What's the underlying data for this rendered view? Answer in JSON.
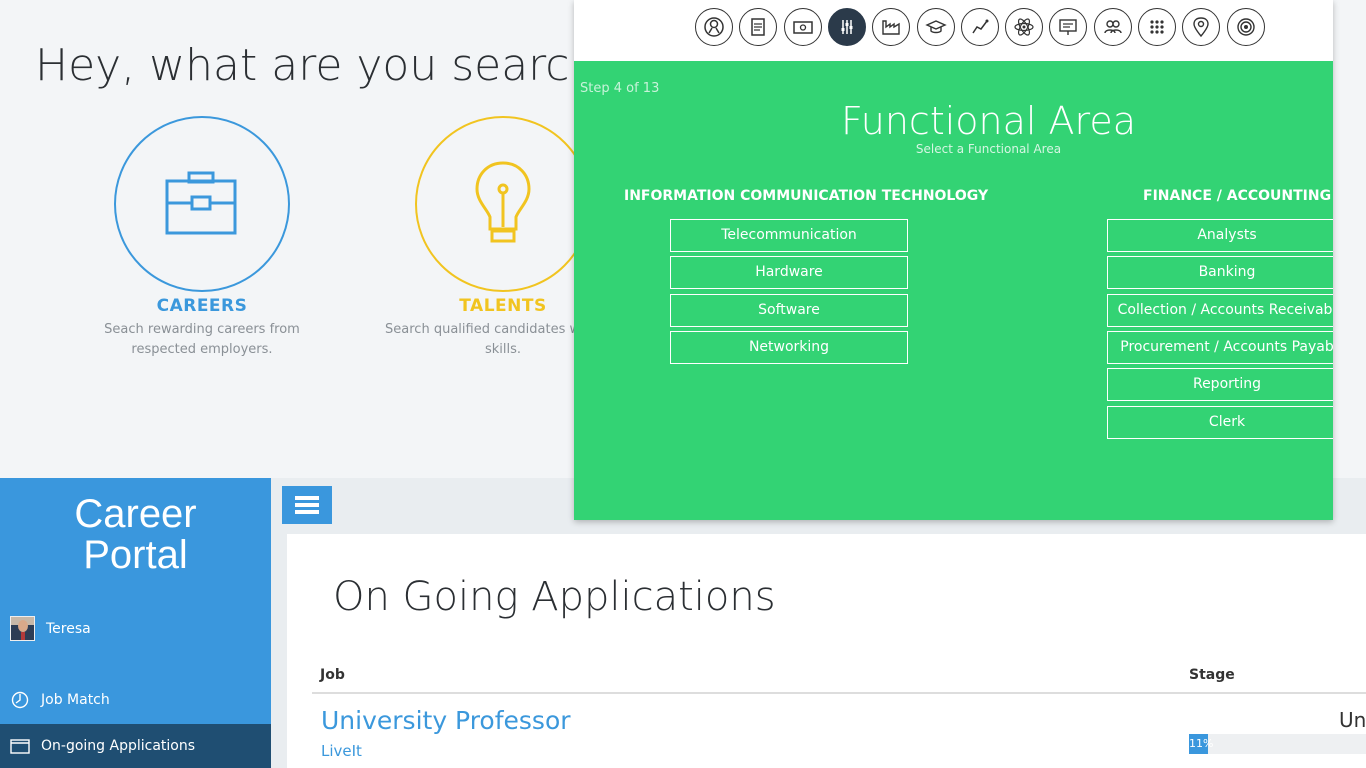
{
  "search": {
    "heading": "Hey, what are you searching",
    "cards": [
      {
        "title": "CAREERS",
        "desc": "Seach rewarding careers from respected employers.",
        "icon": "briefcase-icon",
        "color": "#3b98dc"
      },
      {
        "title": "TALENTS",
        "desc": "Search qualified candidates w notch skills.",
        "icon": "lightbulb-icon",
        "color": "#f1c420"
      }
    ]
  },
  "wizard": {
    "step_label": "Step 4 of 13",
    "title": "Functional Area",
    "subtitle": "Select a Functional Area",
    "accent": "#33d374",
    "step_icons": [
      "person-icon",
      "document-icon",
      "money-icon",
      "sliders-icon",
      "factory-icon",
      "graduation-cap-icon",
      "trend-line-icon",
      "atom-icon",
      "presentation-icon",
      "users-icon",
      "grid-dots-icon",
      "location-pin-icon",
      "target-icon"
    ],
    "active_step": 3,
    "groups": [
      {
        "title": "INFORMATION COMMUNICATION TECHNOLOGY",
        "options": [
          "Telecommunication",
          "Hardware",
          "Software",
          "Networking"
        ]
      },
      {
        "title": "FINANCE / ACCOUNTING",
        "options": [
          "Analysts",
          "Banking",
          "Collection / Accounts Receivabl",
          "Procurement / Accounts Payab",
          "Reporting",
          "Clerk"
        ]
      }
    ]
  },
  "portal": {
    "title_line1": "Career",
    "title_line2": "Portal",
    "user": "Teresa",
    "nav": [
      {
        "label": "Job Match",
        "icon": "compass-icon"
      },
      {
        "label": "On-going Applications",
        "icon": "window-icon"
      }
    ],
    "brand_color": "#3a97dd"
  },
  "applications": {
    "title": "On Going Applications",
    "columns": {
      "job": "Job",
      "stage": "Stage"
    },
    "rows": [
      {
        "job": "University Professor",
        "company": "LiveIt",
        "stage_text": "Un",
        "progress_label": "11%",
        "progress": 0.11
      }
    ]
  }
}
